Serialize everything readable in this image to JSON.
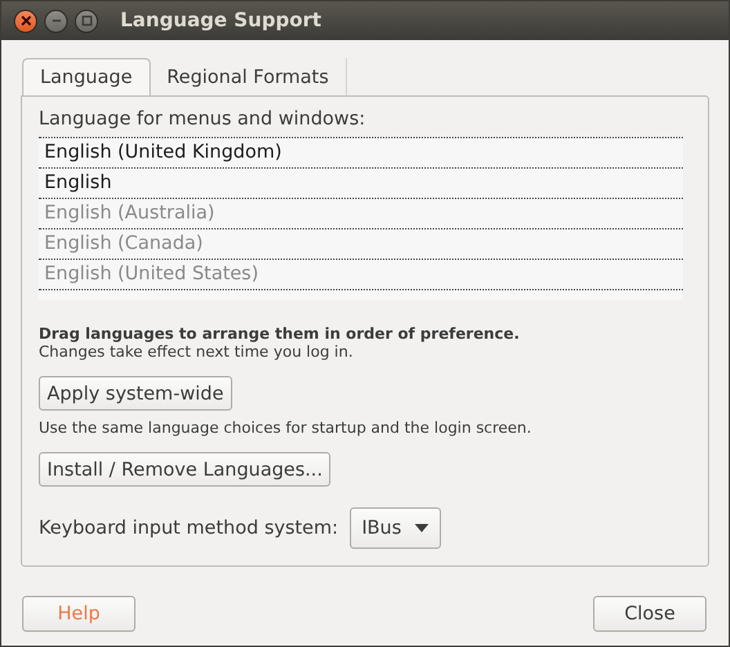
{
  "window": {
    "title": "Language Support"
  },
  "tabs": [
    {
      "label": "Language",
      "selected": true
    },
    {
      "label": "Regional Formats",
      "selected": false
    }
  ],
  "language_list": {
    "label": "Language for menus and windows:",
    "items": [
      {
        "name": "English (United Kingdom)",
        "disabled": false
      },
      {
        "name": "English",
        "disabled": false
      },
      {
        "name": "English (Australia)",
        "disabled": true
      },
      {
        "name": "English (Canada)",
        "disabled": true
      },
      {
        "name": "English (United States)",
        "disabled": true
      }
    ]
  },
  "drag_hint": "Drag languages to arrange them in order of preference.",
  "changes_note": "Changes take effect next time you log in.",
  "apply_button": "Apply system-wide",
  "apply_note": "Use the same language choices for startup and the login screen.",
  "install_button": "Install / Remove Languages...",
  "keyboard_input": {
    "label": "Keyboard input method system:",
    "value": "IBus"
  },
  "buttons": [
    "Help",
    "Close"
  ]
}
